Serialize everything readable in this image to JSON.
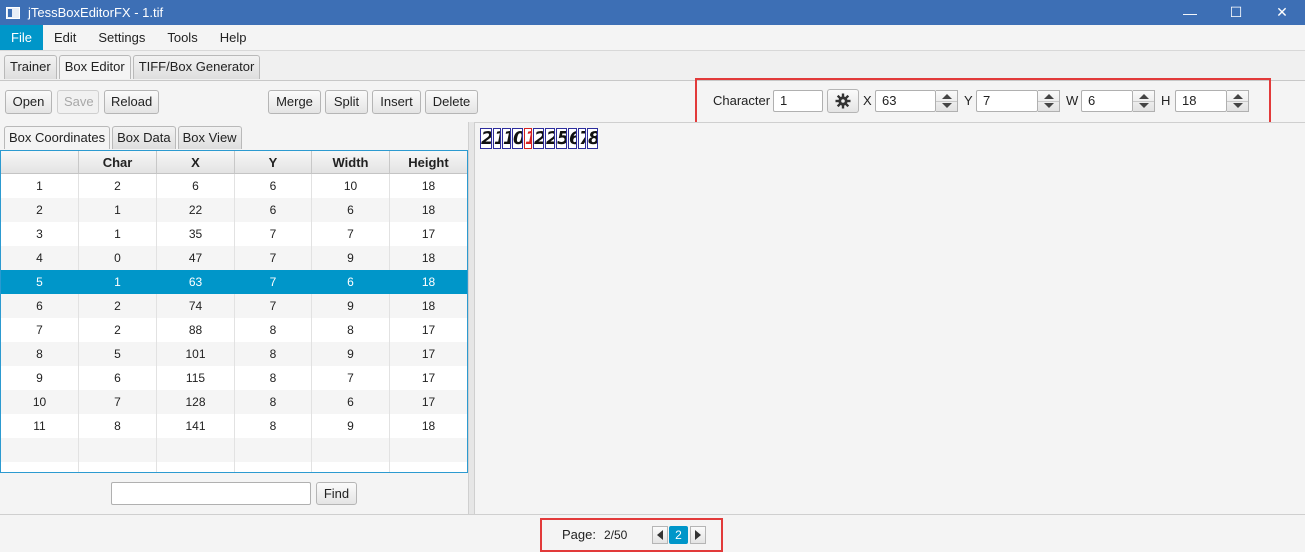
{
  "window": {
    "title": "jTessBoxEditorFX - 1.tif",
    "minimize": "—",
    "maximize": "☐",
    "close": "✕"
  },
  "menu": [
    "File",
    "Edit",
    "Settings",
    "Tools",
    "Help"
  ],
  "top_tabs": [
    "Trainer",
    "Box Editor",
    "TIFF/Box Generator"
  ],
  "toolbar": {
    "open": "Open",
    "save": "Save",
    "reload": "Reload",
    "merge": "Merge",
    "split": "Split",
    "insert": "Insert",
    "delete": "Delete"
  },
  "editor": {
    "character_label": "Character",
    "character_value": "1",
    "x_label": "X",
    "x_value": "63",
    "y_label": "Y",
    "y_value": "7",
    "w_label": "W",
    "w_value": "6",
    "h_label": "H",
    "h_value": "18"
  },
  "sub_tabs": [
    "Box Coordinates",
    "Box Data",
    "Box View"
  ],
  "table": {
    "columns": [
      "",
      "Char",
      "X",
      "Y",
      "Width",
      "Height"
    ],
    "selected_index": 4,
    "rows": [
      [
        "1",
        "2",
        "6",
        "6",
        "10",
        "18"
      ],
      [
        "2",
        "1",
        "22",
        "6",
        "6",
        "18"
      ],
      [
        "3",
        "1",
        "35",
        "7",
        "7",
        "17"
      ],
      [
        "4",
        "0",
        "47",
        "7",
        "9",
        "18"
      ],
      [
        "5",
        "1",
        "63",
        "7",
        "6",
        "18"
      ],
      [
        "6",
        "2",
        "74",
        "7",
        "9",
        "18"
      ],
      [
        "7",
        "2",
        "88",
        "8",
        "8",
        "17"
      ],
      [
        "8",
        "5",
        "101",
        "8",
        "9",
        "17"
      ],
      [
        "9",
        "6",
        "115",
        "8",
        "7",
        "17"
      ],
      [
        "10",
        "7",
        "128",
        "8",
        "6",
        "17"
      ],
      [
        "11",
        "8",
        "141",
        "8",
        "9",
        "18"
      ]
    ]
  },
  "find": {
    "button": "Find",
    "value": ""
  },
  "image_glyphs": [
    "2",
    "1",
    "1",
    "0",
    "1",
    "2",
    "2",
    "5",
    "6",
    "7",
    "8"
  ],
  "glyph_active_index": 4,
  "status": {
    "page_label": "Page:",
    "page_count": "2/50",
    "current_page": "2"
  },
  "colors": {
    "accent": "#0096c9",
    "titlebar": "#3d6fb5",
    "highlight_border": "#e23a3a"
  }
}
